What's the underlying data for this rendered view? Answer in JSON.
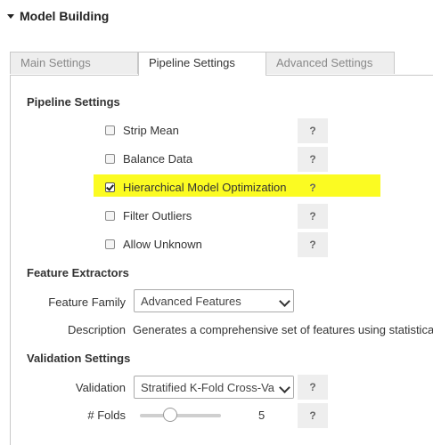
{
  "section": {
    "title": "Model Building"
  },
  "tabs": [
    {
      "label": "Main Settings",
      "active": false
    },
    {
      "label": "Pipeline Settings",
      "active": true
    },
    {
      "label": "Advanced Settings",
      "active": false
    }
  ],
  "pipeline": {
    "title": "Pipeline Settings",
    "options": [
      {
        "label": "Strip Mean",
        "checked": false,
        "help": "?"
      },
      {
        "label": "Balance Data",
        "checked": false,
        "help": "?"
      },
      {
        "label": "Hierarchical Model Optimization",
        "checked": true,
        "help": "?",
        "highlighted": true
      },
      {
        "label": "Filter Outliers",
        "checked": false,
        "help": "?"
      },
      {
        "label": "Allow Unknown",
        "checked": false,
        "help": "?"
      }
    ]
  },
  "features": {
    "title": "Feature Extractors",
    "family_label": "Feature Family",
    "family_value": "Advanced Features",
    "description_label": "Description",
    "description_text": "Generates a comprehensive set of features using statistica"
  },
  "validation": {
    "title": "Validation Settings",
    "validation_label": "Validation",
    "validation_value": "Stratified K-Fold Cross-Va",
    "validation_help": "?",
    "folds_label": "# Folds",
    "folds_value": "5",
    "folds_help": "?"
  },
  "colors": {
    "highlight": "#fbfb22",
    "help_bg": "#eeeeee",
    "tab_inactive": "#eeeeee"
  }
}
